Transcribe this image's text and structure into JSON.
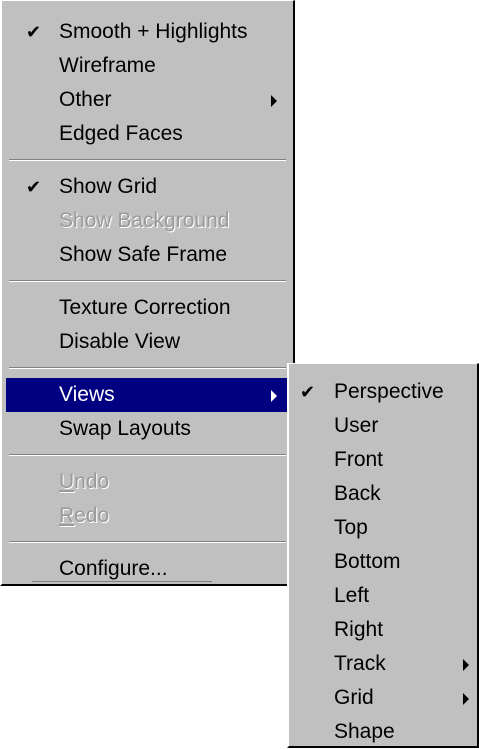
{
  "main_menu": {
    "groups": [
      [
        {
          "label": "Smooth + Highlights",
          "checked": true
        },
        {
          "label": "Wireframe"
        },
        {
          "label": "Other",
          "submenu": true
        },
        {
          "label": "Edged Faces"
        }
      ],
      [
        {
          "label": "Show Grid",
          "checked": true
        },
        {
          "label": "Show Background",
          "disabled": true
        },
        {
          "label": "Show Safe Frame"
        }
      ],
      [
        {
          "label": "Texture Correction"
        },
        {
          "label": "Disable View"
        }
      ],
      [
        {
          "label": "Views",
          "submenu": true,
          "highlighted": true
        },
        {
          "label": "Swap Layouts"
        }
      ],
      [
        {
          "label": "Undo",
          "disabled": true,
          "mnemonic": "U"
        },
        {
          "label": "Redo",
          "disabled": true,
          "mnemonic": "R"
        }
      ],
      [
        {
          "label": "Configure..."
        }
      ]
    ]
  },
  "views_submenu": {
    "items": [
      {
        "label": "Perspective",
        "checked": true
      },
      {
        "label": "User"
      },
      {
        "label": "Front"
      },
      {
        "label": "Back"
      },
      {
        "label": "Top"
      },
      {
        "label": "Bottom"
      },
      {
        "label": "Left"
      },
      {
        "label": "Right"
      },
      {
        "label": "Track",
        "submenu": true
      },
      {
        "label": "Grid",
        "submenu": true
      },
      {
        "label": "Shape"
      }
    ]
  },
  "check_glyph": "✔",
  "colors": {
    "menu_bg": "#c0c0c0",
    "highlight": "#000080",
    "disabled_text": "#9a9a9a"
  }
}
